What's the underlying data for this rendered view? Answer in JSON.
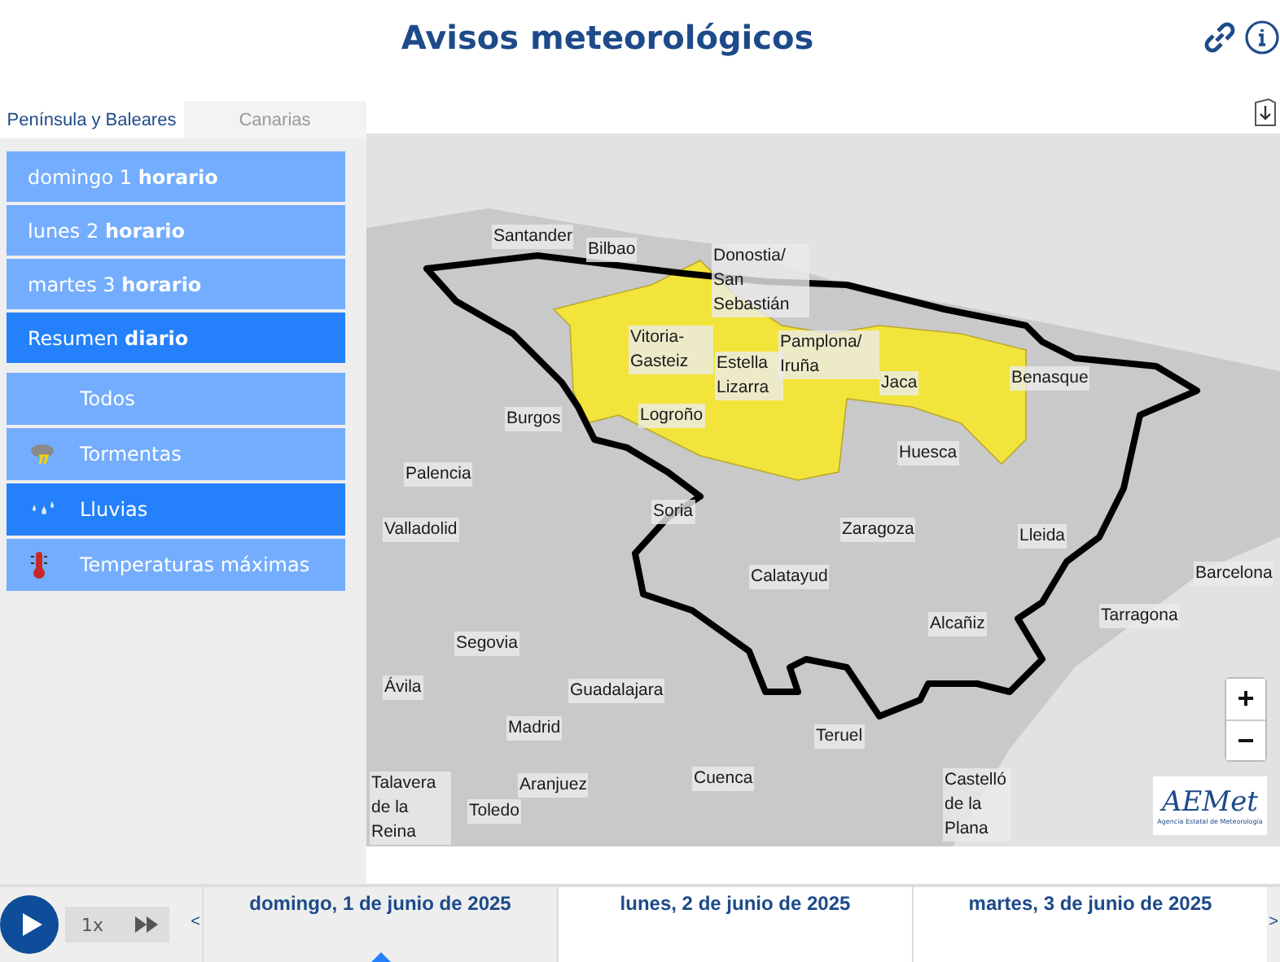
{
  "header": {
    "title": "Avisos meteorológicos"
  },
  "region_tabs": [
    {
      "label": "Península y Baleares",
      "selected": true
    },
    {
      "label": "Canarias",
      "selected": false
    }
  ],
  "period_menu": [
    {
      "label": "domingo 1 **horario**",
      "selected": false
    },
    {
      "label": "lunes 2 **horario**",
      "selected": false
    },
    {
      "label": "martes 3 **horario**",
      "selected": false
    },
    {
      "label": "Resumen **diario**",
      "selected": true
    }
  ],
  "phenomena": [
    {
      "kind": "none",
      "label": "Todos",
      "selected": false
    },
    {
      "kind": "storm",
      "label": "Tormentas",
      "selected": false
    },
    {
      "kind": "rain",
      "label": "Lluvias",
      "selected": true
    },
    {
      "kind": "heat",
      "label": "Temperaturas máximas",
      "selected": false
    }
  ],
  "map": {
    "cities": [
      "Santander",
      "Bilbao",
      "Donostia/ San Sebastián",
      "Vitoria- Gasteiz",
      "Estella Lizarra",
      "Pamplona/ Iruña",
      "Logroño",
      "Jaca",
      "Benasque",
      "Burgos",
      "Huesca",
      "Palencia",
      "Soria",
      "Zaragoza",
      "Lleida",
      "Valladolid",
      "Barcelona",
      "Calatayud",
      "Tarragona",
      "Alcañiz",
      "Segovia",
      "Ávila",
      "Guadalajara",
      "Madrid",
      "Teruel",
      "Talavera de la Reina",
      "Aranjuez",
      "Cuenca",
      "Toledo",
      "Castelló de la Plana"
    ],
    "zoom_in": "+",
    "zoom_out": "−",
    "logo": {
      "name": "AEMet",
      "subtitle": "Agencia Estatal de Meteorología"
    }
  },
  "player": {
    "speed": "1x",
    "prev": "<",
    "next": ">"
  },
  "days": [
    {
      "label": "domingo, 1 de junio de 2025",
      "selected": true
    },
    {
      "label": "lunes, 2 de junio de 2025",
      "selected": false
    },
    {
      "label": "martes, 3 de junio de 2025",
      "selected": false
    }
  ]
}
